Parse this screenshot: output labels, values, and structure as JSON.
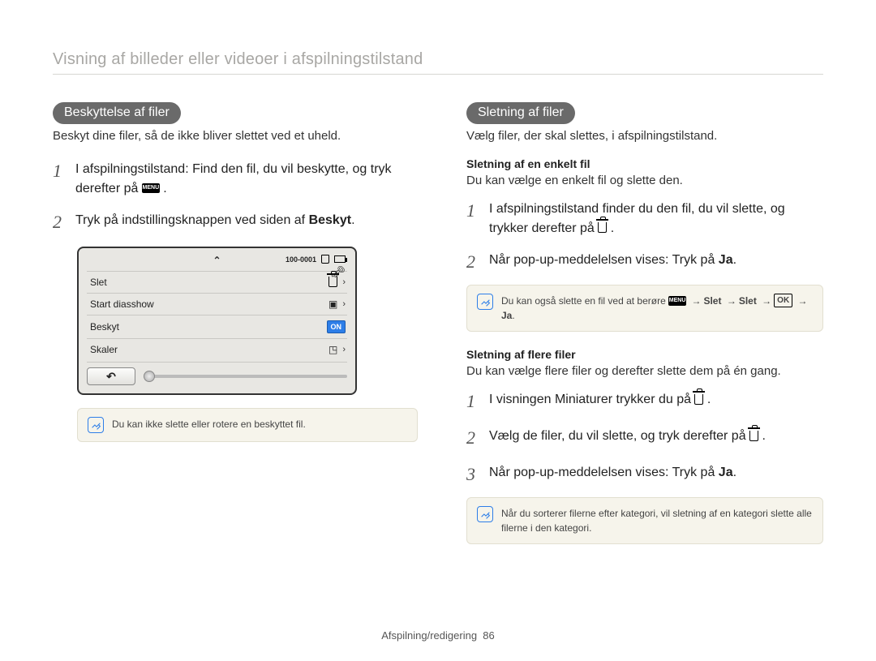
{
  "breadcrumb": "Visning af billeder eller videoer i afspilningstilstand",
  "left": {
    "pill": "Beskyttelse af filer",
    "intro": "Beskyt dine filer, så de ikke bliver slettet ved et uheld.",
    "steps": {
      "s1a": "I afspilningstilstand: Find den fil, du vil beskytte, og tryk derefter på ",
      "s1b": ".",
      "s2a": "Tryk på indstillingsknappen ved siden af ",
      "s2b": "Beskyt",
      "s2c": "."
    },
    "screen": {
      "fileno": "100-0001",
      "items": {
        "slet": "Slet",
        "diasshow": "Start diasshow",
        "beskyt": "Beskyt",
        "skaler": "Skaler"
      },
      "on": "ON"
    },
    "note": "Du kan ikke slette eller rotere en beskyttet fil."
  },
  "right": {
    "pill": "Sletning af filer",
    "intro": "Vælg filer, der skal slettes, i afspilningstilstand.",
    "sub1_head": "Sletning af en enkelt fil",
    "sub1_intro": "Du kan vælge en enkelt fil og slette den.",
    "sub1_steps": {
      "s1a": "I afspilningstilstand finder du den fil, du vil slette, og trykker derefter på ",
      "s1b": ".",
      "s2a": "Når pop-up-meddelelsen vises: Tryk på ",
      "s2b": "Ja",
      "s2c": "."
    },
    "note1": {
      "a": "Du kan også slette en fil ved at berøre ",
      "menu": "MENU",
      "slet": "Slet",
      "ok": "OK",
      "ja": "Ja",
      "end": "."
    },
    "sub2_head": "Sletning af flere filer",
    "sub2_intro": "Du kan vælge flere filer og derefter slette dem på én gang.",
    "sub2_steps": {
      "s1a": "I visningen Miniaturer trykker du på ",
      "s1b": ".",
      "s2a": "Vælg de filer, du vil slette, og tryk derefter på ",
      "s2b": ".",
      "s3a": "Når pop-up-meddelelsen vises: Tryk på ",
      "s3b": "Ja",
      "s3c": "."
    },
    "note2": "Når du sorterer filerne efter kategori, vil sletning af en kategori slette alle filerne i den kategori."
  },
  "footer": {
    "section": "Afspilning/redigering",
    "page": "86"
  }
}
